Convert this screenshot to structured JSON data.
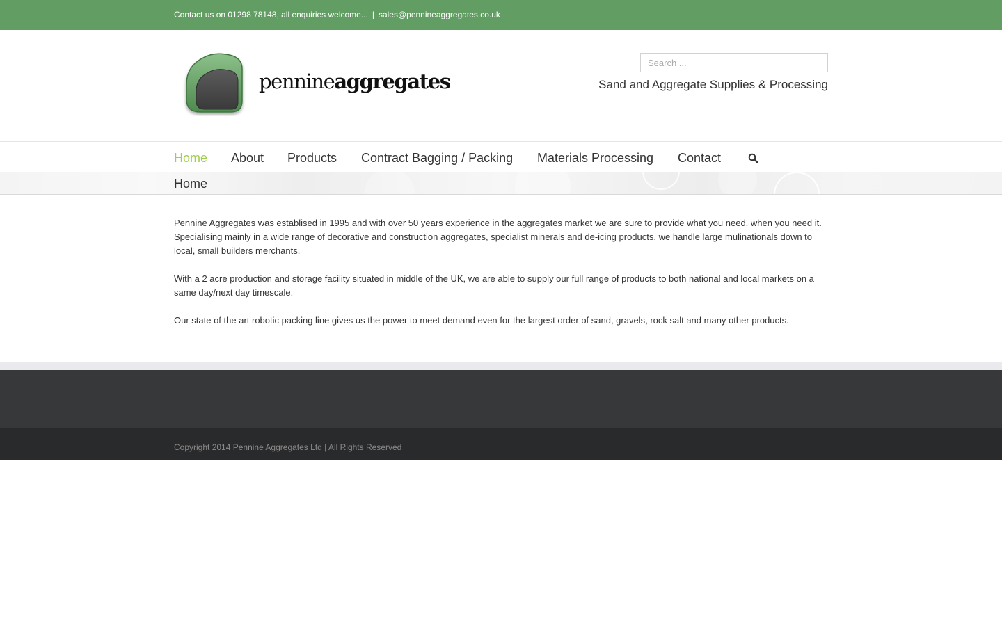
{
  "topbar": {
    "contact_text": "Contact us on 01298 78148, all enquiries welcome...",
    "separator": "|",
    "email": "sales@pennineaggregates.co.uk"
  },
  "header": {
    "logo_word_1": "pennine",
    "logo_word_2": "aggregates",
    "search_placeholder": "Search ...",
    "tagline": "Sand and Aggregate Supplies & Processing"
  },
  "nav": {
    "items": [
      {
        "label": "Home",
        "active": true
      },
      {
        "label": "About"
      },
      {
        "label": "Products"
      },
      {
        "label": "Contract Bagging / Packing"
      },
      {
        "label": "Materials Processing"
      },
      {
        "label": "Contact"
      }
    ],
    "search_icon": "search-icon"
  },
  "page_title": "Home",
  "content": {
    "paragraphs": [
      "Pennine Aggregates was establised in 1995 and with over 50 years experience in the aggregates market we are sure to provide what you need, when you need it. Specialising mainly in a wide range of decorative and construction aggregates, specialist minerals and de-icing products, we handle large mulinationals down to local, small builders merchants.",
      "With a 2 acre production and storage facility situated in middle of the UK, we are able to supply our full range of products to both national and local markets on a same day/next day timescale.",
      "Our state of the art robotic packing line gives us the power to meet demand even for the largest order of sand, gravels, rock salt and many other products."
    ]
  },
  "footer": {
    "copyright": "Copyright 2014 Pennine Aggregates Ltd | All Rights Reserved"
  },
  "colors": {
    "topbar": "#629e64",
    "nav_active": "#a0ce4e",
    "footer_widgets": "#363839",
    "footer_bottom": "#282a2b",
    "logo_green": "#6ea46a",
    "logo_dark": "#4a4a4a"
  }
}
